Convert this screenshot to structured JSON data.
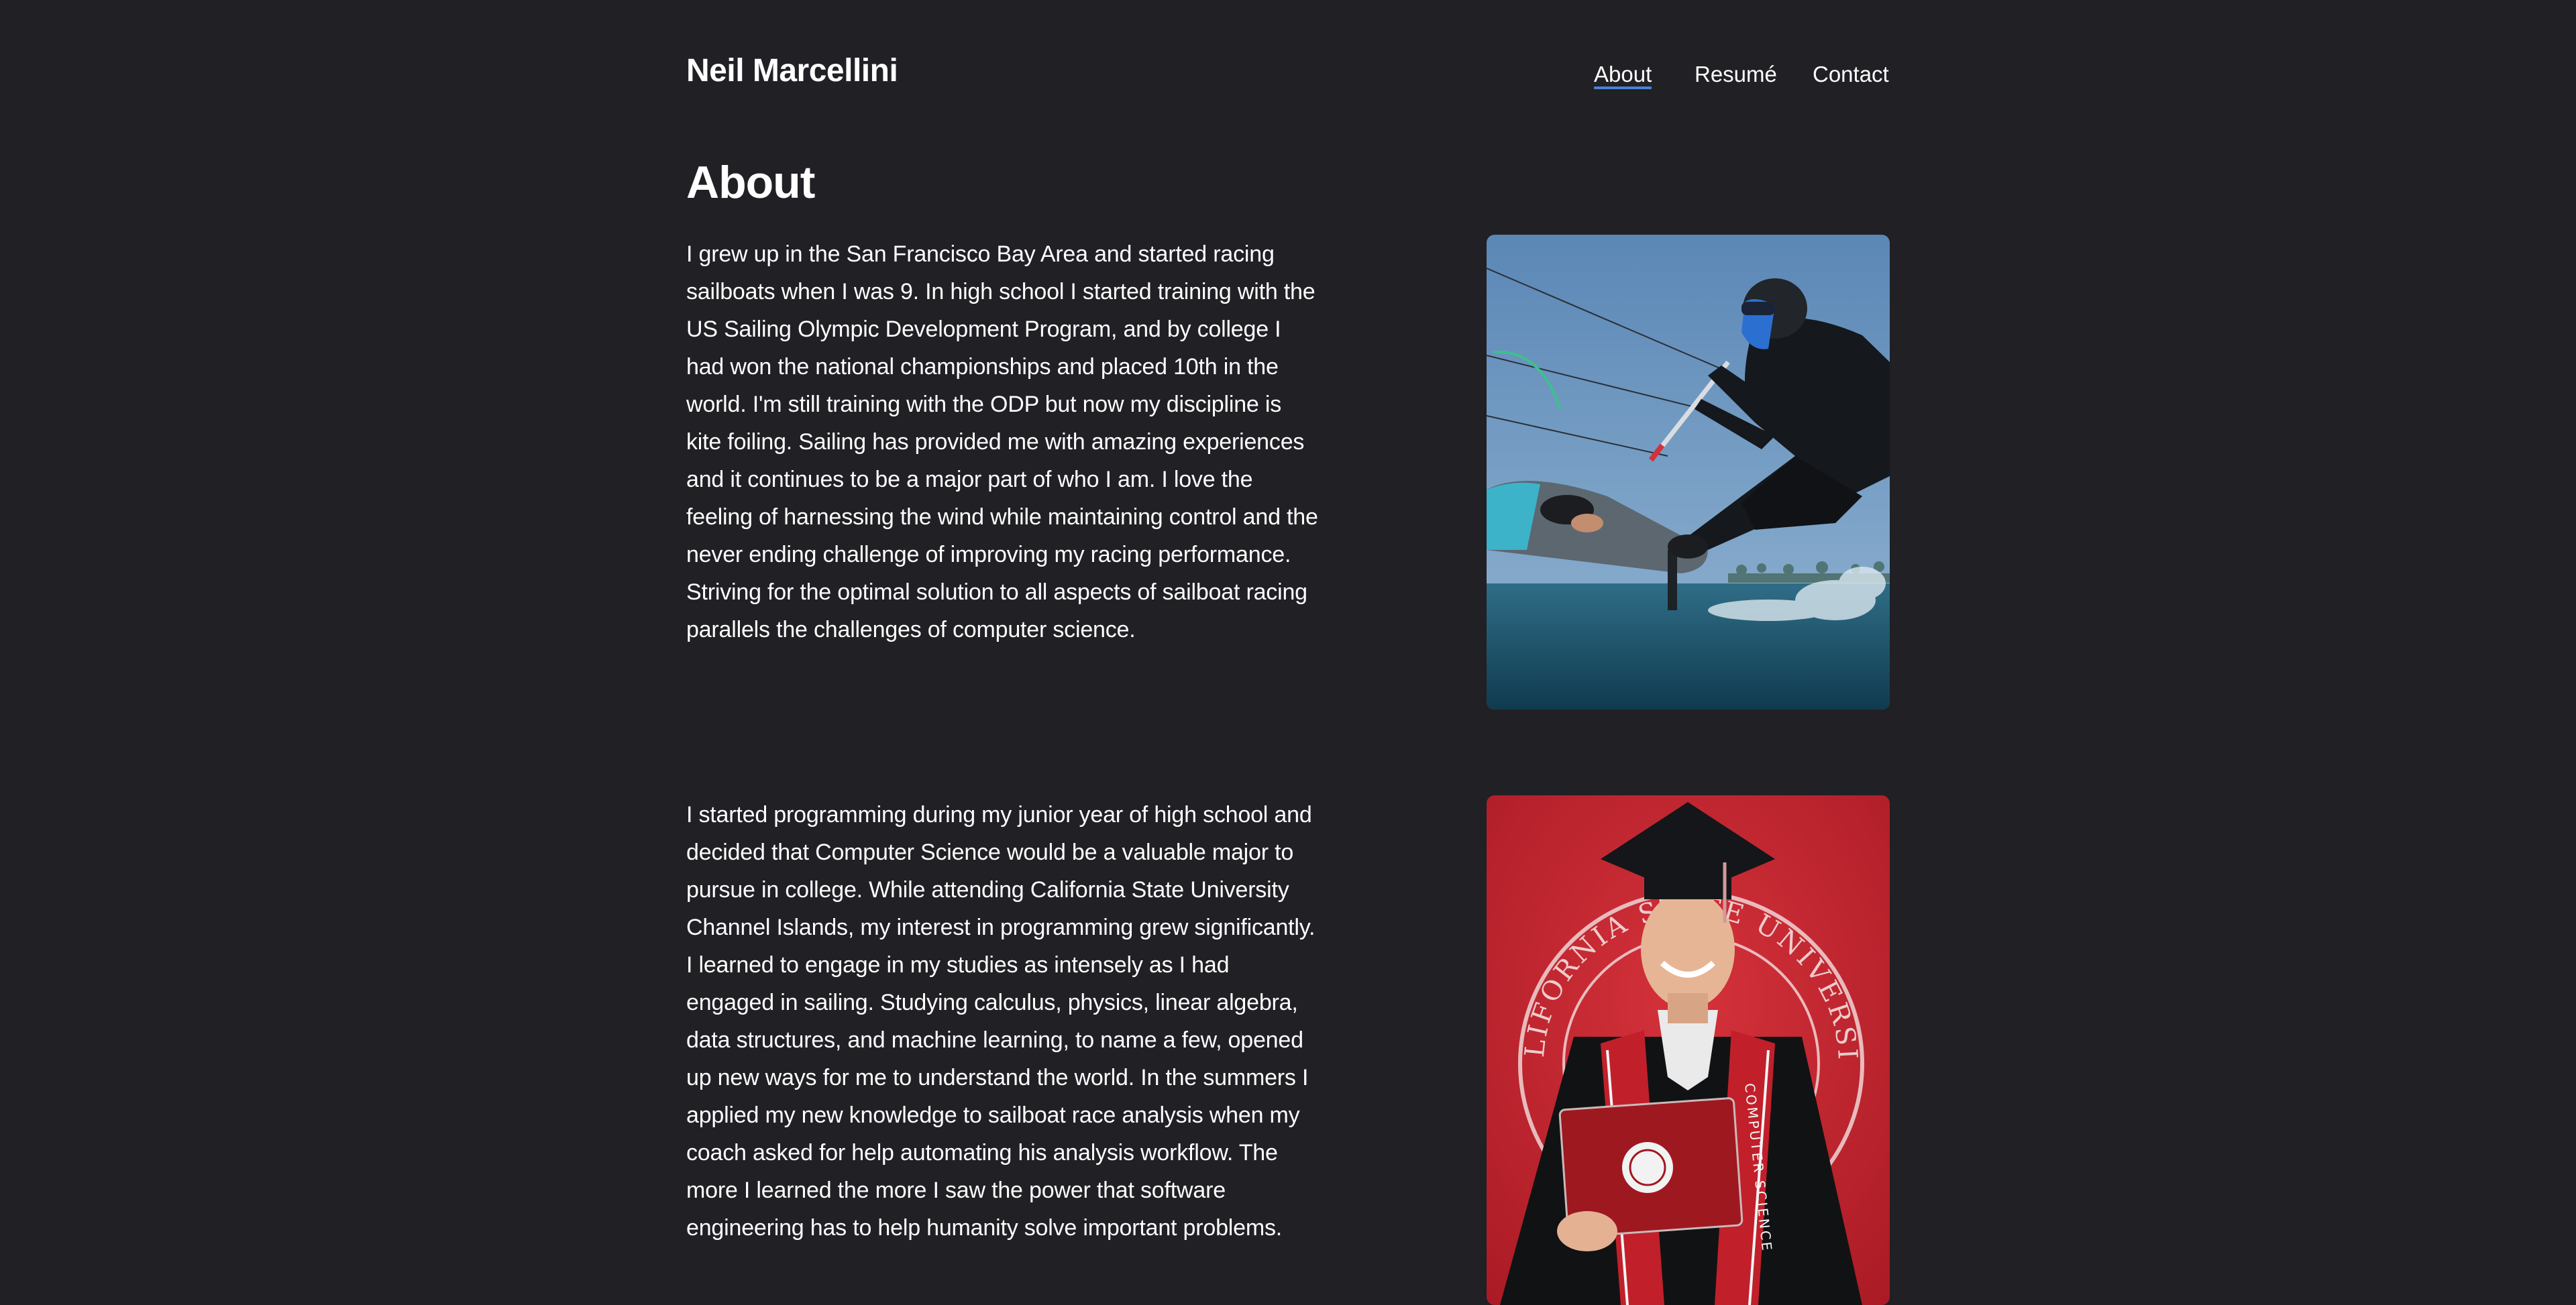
{
  "header": {
    "site_title": "Neil Marcellini",
    "nav": [
      {
        "label": "About",
        "active": true
      },
      {
        "label": "Resumé",
        "active": false
      },
      {
        "label": "Contact",
        "active": false
      }
    ]
  },
  "main": {
    "page_title": "About",
    "sections": [
      {
        "text": "I grew up in the San Francisco Bay Area and started racing sailboats when I was 9. In high school I started training with the US Sailing Olympic Development Program, and by college I had won the national championships and placed 10th in the world. I'm still training with the ODP but now my discipline is kite foiling. Sailing has provided me with amazing experiences and it continues to be a major part of who I am. I love the feeling of harnessing the wind while maintaining control and the never ending challenge of improving my racing performance. Striving for the optimal solution to all aspects of sailboat racing parallels the challenges of computer science.",
        "image": "kite-foiling-photo"
      },
      {
        "text": "I started programming during my junior year of high school and decided that Computer Science would be a valuable major to pursue in college. While attending California State University Channel Islands, my interest in programming grew significantly. I learned to engage in my studies as intensely as I had engaged in sailing. Studying calculus, physics, linear algebra, data structures, and machine learning, to name a few, opened up new ways for me to understand the world. In the summers I applied my new knowledge to sailboat race analysis when my coach asked for help automating his analysis workflow. The more I learned the more I saw the power that software engineering has to help humanity solve important problems.",
        "image": "graduation-photo"
      }
    ]
  },
  "graduation_photo": {
    "seal_text": "CALIFORNIA STATE UNIVERSITY",
    "stole_text": "COMPUTER SCIENCE"
  },
  "colors": {
    "background": "#202025",
    "text": "#ffffff",
    "nav_underline": "#4a82d6",
    "graduation_backdrop": "#c8232e"
  }
}
